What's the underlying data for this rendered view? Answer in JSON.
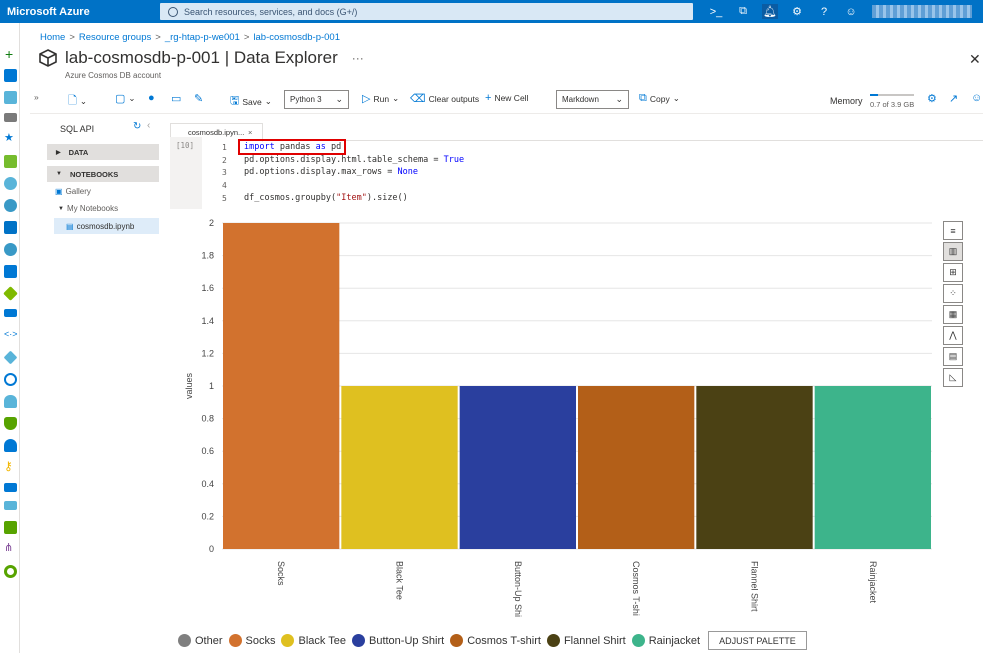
{
  "topbar": {
    "brand": "Microsoft Azure",
    "search_placeholder": "Search resources, services, and docs (G+/)",
    "icons": [
      "cloud-shell-icon",
      "directory-filter-icon",
      "notifications-icon",
      "settings-icon",
      "help-icon",
      "feedback-icon"
    ]
  },
  "breadcrumb": [
    "Home",
    "Resource groups",
    "_rg-htap-p-we001",
    "lab-cosmosdb-p-001"
  ],
  "header": {
    "title": "lab-cosmosdb-p-001 | Data Explorer",
    "more": "···",
    "subtitle": "Azure Cosmos DB account",
    "close": "✕"
  },
  "toolbar": {
    "save": "Save",
    "kernel": "Python 3",
    "run": "Run",
    "clear_outputs": "Clear outputs",
    "new_cell": "New Cell",
    "cell_type": "Markdown",
    "copy": "Copy",
    "memory_label": "Memory",
    "memory_value": "0.7 of 3.9 GB",
    "memory_fraction": 0.18
  },
  "sidebar": {
    "api": "SQL API",
    "sections": [
      "DATA",
      "NOTEBOOKS"
    ],
    "gallery": "Gallery",
    "my_notebooks": "My Notebooks",
    "file": "cosmosdb.ipynb"
  },
  "notebook": {
    "tab": "cosmosdb.ipyn...",
    "tab_close": "×",
    "exec_count": "[10]",
    "line_numbers": [
      "1",
      "2",
      "3",
      "4",
      "5"
    ],
    "lines": [
      {
        "kw": "import",
        "rest": " pandas ",
        "kw2": "as",
        "rest2": " pd"
      },
      {
        "text": "pd.options.display.html.table_schema = ",
        "kw": "True"
      },
      {
        "text": "pd.options.display.max_rows = ",
        "kw": "None"
      },
      {
        "text": ""
      },
      {
        "text": "df_cosmos.groupby(",
        "str": "\"Item\"",
        "text2": ").size()"
      }
    ]
  },
  "chart_data": {
    "type": "bar",
    "categories": [
      "Socks",
      "Black Tee",
      "Button-Up Shi",
      "Cosmos T-shi",
      "Flannel Shirt",
      "Rainjacket"
    ],
    "values": [
      2,
      1,
      1,
      1,
      1,
      1
    ],
    "colors": [
      "#d2722e",
      "#dfc020",
      "#2a3f9e",
      "#b35f18",
      "#4b4114",
      "#3db48b"
    ],
    "ylabel": "values",
    "ylim": [
      0,
      2
    ],
    "yticks": [
      "0",
      "0.2",
      "0.4",
      "0.6",
      "0.8",
      "1",
      "1.2",
      "1.4",
      "1.6",
      "1.8",
      "2"
    ],
    "grid": true
  },
  "legend": {
    "items": [
      {
        "label": "Other",
        "color": "#7f7f7f"
      },
      {
        "label": "Socks",
        "color": "#d2722e"
      },
      {
        "label": "Black Tee",
        "color": "#dfc020"
      },
      {
        "label": "Button-Up Shirt",
        "color": "#2a3f9e"
      },
      {
        "label": "Cosmos T-shirt",
        "color": "#b35f18"
      },
      {
        "label": "Flannel Shirt",
        "color": "#4b4114"
      },
      {
        "label": "Rainjacket",
        "color": "#3db48b"
      }
    ],
    "adjust_palette": "ADJUST PALETTE"
  }
}
